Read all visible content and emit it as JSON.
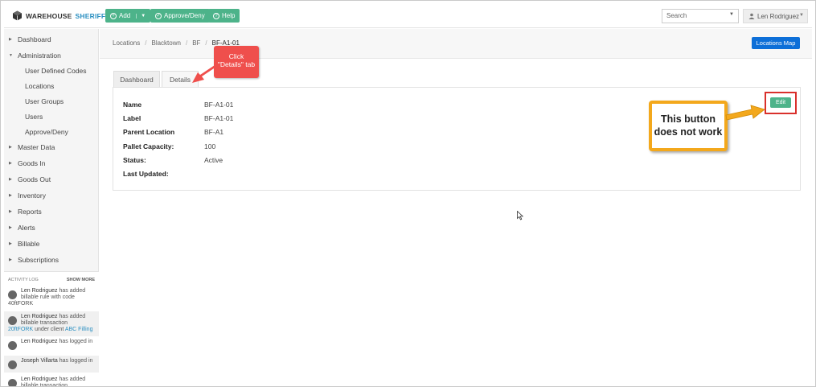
{
  "header": {
    "logo_part1": "WAREHOUSE",
    "logo_part2": "SHERIFF",
    "add_label": "Add",
    "approve_label": "Approve/Deny",
    "help_label": "Help",
    "search_placeholder": "Search",
    "user_name": "Len Rodriguez",
    "brand_color": "#4db38a",
    "icons": [
      "warehouse-logo-icon",
      "plus-circle-icon",
      "check-circle-icon",
      "question-circle-icon",
      "chevron-down-icon",
      "user-icon"
    ]
  },
  "sidebar": {
    "items": [
      {
        "label": "Dashboard"
      },
      {
        "label": "Administration"
      },
      {
        "label": "User Defined Codes"
      },
      {
        "label": "Locations"
      },
      {
        "label": "User Groups"
      },
      {
        "label": "Users"
      },
      {
        "label": "Approve/Deny"
      },
      {
        "label": "Master Data"
      },
      {
        "label": "Goods In"
      },
      {
        "label": "Goods Out"
      },
      {
        "label": "Inventory"
      },
      {
        "label": "Reports"
      },
      {
        "label": "Alerts"
      },
      {
        "label": "Billable"
      },
      {
        "label": "Subscriptions"
      }
    ]
  },
  "activity": {
    "title": "ACTIVITY LOG",
    "show_more": "SHOW MORE",
    "entries": [
      {
        "name": "Len Rodriguez",
        "text": "has added billable rule with code",
        "extra": "40ftFORK"
      },
      {
        "name": "Len Rodriguez",
        "text": "has added billable transaction",
        "extra": "20ftFORK",
        "extra2": "under client",
        "link": "ABC Filling"
      },
      {
        "name": "Len Rodriguez",
        "text": "has logged in"
      },
      {
        "name": "Joseph Villarta",
        "text": "has logged in"
      },
      {
        "name": "Len Rodriguez",
        "text": "has added billable transaction"
      }
    ]
  },
  "breadcrumb": {
    "items": [
      "Locations",
      "Blacktown",
      "BF",
      "BF-A1-01"
    ],
    "locations_map_label": "Locations Map",
    "button_color": "#0d6fd8"
  },
  "tabs": [
    {
      "label": "Dashboard",
      "active": false
    },
    {
      "label": "Details",
      "active": true
    }
  ],
  "details": {
    "fields": [
      {
        "label": "Name",
        "value": "BF-A1-01"
      },
      {
        "label": "Label",
        "value": "BF-A1-01"
      },
      {
        "label": "Parent Location",
        "value": "BF-A1"
      },
      {
        "label": "Pallet Capacity:",
        "value": "100"
      },
      {
        "label": "Status:",
        "value": "Active"
      },
      {
        "label": "Last Updated:",
        "value": ""
      }
    ],
    "edit_label": "Edit"
  },
  "annotations": {
    "click_line1": "Click",
    "click_line2": "\"Details\" tab",
    "note_line1": "This button",
    "note_line2": "does not work",
    "red_color": "#ef4f4c",
    "orange_color": "#f3a81c"
  }
}
